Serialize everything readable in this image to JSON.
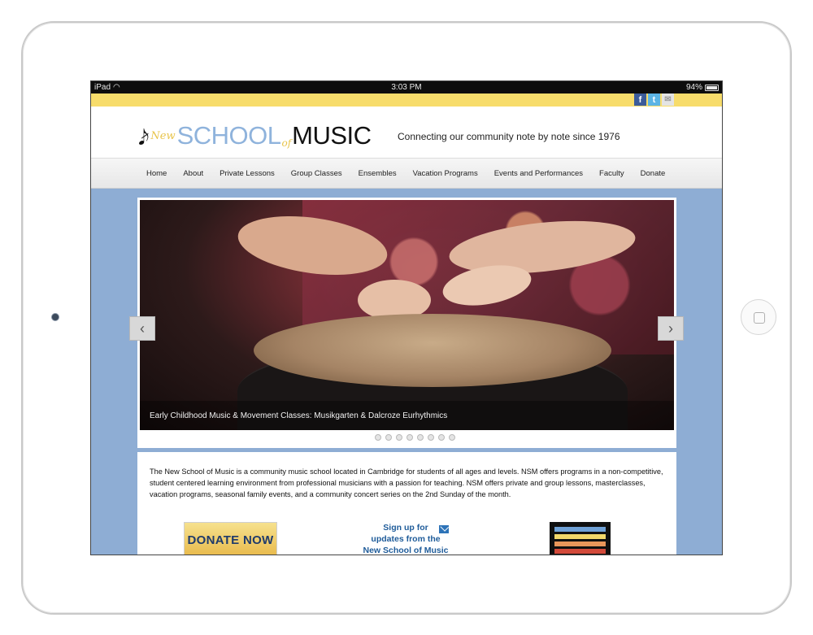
{
  "status_bar": {
    "device": "iPad",
    "time": "3:03 PM",
    "battery": "94%"
  },
  "social": {
    "facebook": "f",
    "twitter": "t",
    "email": "✉"
  },
  "header": {
    "logo_new": "New",
    "logo_school": "SCHOOL",
    "logo_of": "of",
    "logo_music": "MUSIC",
    "tagline": "Connecting our community note by note since 1976"
  },
  "nav": {
    "items": [
      {
        "label": "Home"
      },
      {
        "label": "About"
      },
      {
        "label": "Private Lessons"
      },
      {
        "label": "Group Classes"
      },
      {
        "label": "Ensembles"
      },
      {
        "label": "Vacation Programs"
      },
      {
        "label": "Events and Performances"
      },
      {
        "label": "Faculty"
      },
      {
        "label": "Donate"
      }
    ]
  },
  "slider": {
    "caption": "Early Childhood Music & Movement Classes: Musikgarten & Dalcroze Eurhythmics",
    "prev_label": "‹",
    "next_label": "›",
    "dot_count": 8
  },
  "intro": {
    "text": "The New School of Music is a community music school located in Cambridge for students of all ages and levels. NSM offers programs in a non-competitive, student centered learning environment from professional musicians with a passion for teaching. NSM offers private and group lessons, masterclasses, vacation programs, seasonal family events, and a community concert series on the 2nd Sunday of the month."
  },
  "promo": {
    "donate_label": "DONATE NOW",
    "signup_line1": "Sign up for",
    "signup_line2": "updates from the",
    "signup_line3": "New School of Music"
  },
  "colors": {
    "accent_yellow": "#f7dc6b",
    "background_blue": "#8eadd4",
    "logo_blue": "#8fb3dc"
  }
}
